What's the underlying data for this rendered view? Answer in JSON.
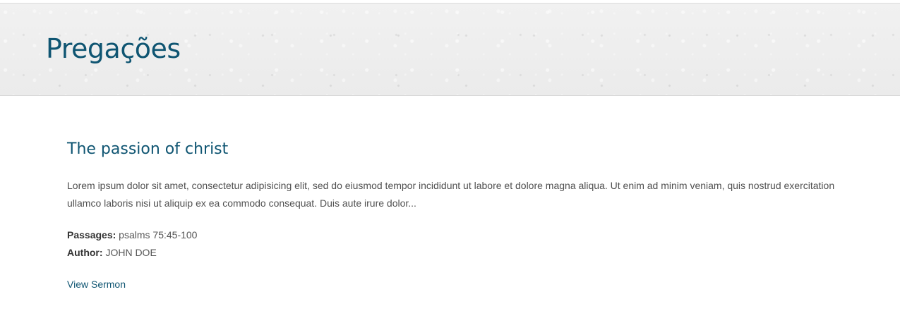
{
  "header": {
    "title": "Pregações"
  },
  "sermon": {
    "title": "The passion of christ",
    "excerpt": "Lorem ipsum dolor sit amet, consectetur adipisicing elit, sed do eiusmod tempor incididunt ut labore et dolore magna aliqua. Ut enim ad minim veniam, quis nostrud exercitation ullamco laboris nisi ut aliquip ex ea commodo consequat. Duis aute irure dolor...",
    "passages": {
      "label": "Passages:",
      "value": "psalms 75:45-100"
    },
    "author": {
      "label": "Author:",
      "value": "JOHN DOE"
    },
    "link_label": "View Sermon"
  },
  "colors": {
    "accent": "#0f5572",
    "text": "#505050",
    "header_bg": "#eeeeee"
  }
}
